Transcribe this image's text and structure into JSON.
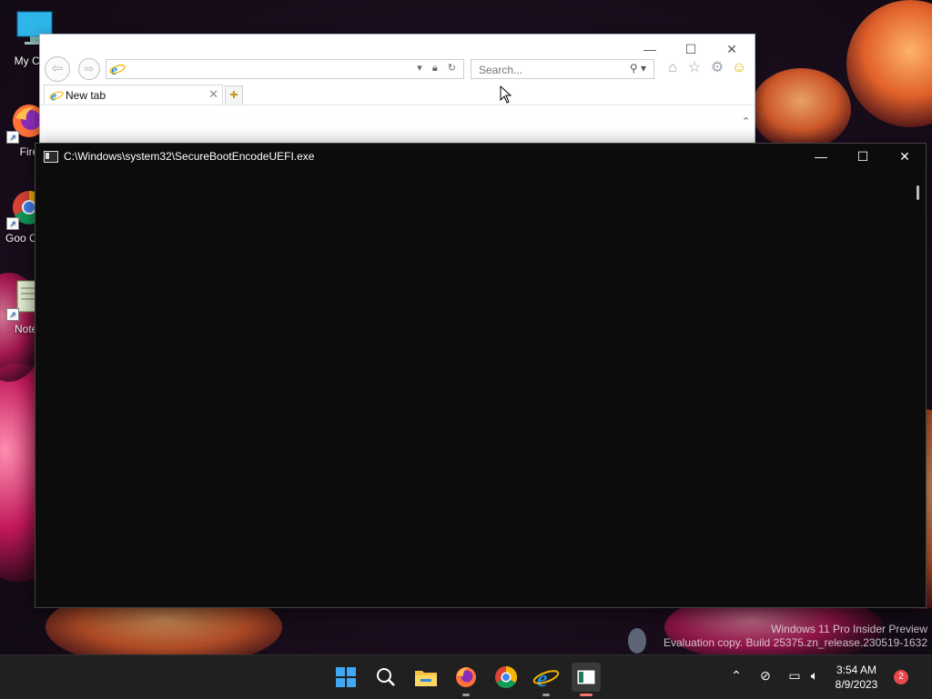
{
  "desktop": {
    "icons": [
      {
        "label": "My Com",
        "icon": "computer-icon"
      },
      {
        "label": "Fire",
        "icon": "firefox-icon"
      },
      {
        "label": "Goo Chro",
        "icon": "chrome-icon"
      },
      {
        "label": "Notep",
        "icon": "notepad-icon"
      }
    ],
    "watermark": {
      "line1": "Windows 11 Pro Insider Preview",
      "line2": "Evaluation copy. Build 25375.zn_release.230519-1632"
    }
  },
  "ie_window": {
    "caption_buttons": {
      "minimize": "—",
      "maximize": "☐",
      "close": "✕"
    },
    "address_value": "",
    "search_placeholder": "Search...",
    "tab_label": "New tab",
    "toolbar_icons": [
      "home-icon",
      "favorites-star-icon",
      "settings-gear-icon",
      "smiley-feedback-icon"
    ]
  },
  "console_window": {
    "title": "C:\\Windows\\system32\\SecureBootEncodeUEFI.exe",
    "caption_buttons": {
      "minimize": "—",
      "maximize": "☐",
      "close": "✕"
    },
    "content": ""
  },
  "taskbar": {
    "apps": [
      "start-icon",
      "search-icon",
      "file-explorer-icon",
      "firefox-icon",
      "chrome-icon",
      "internet-explorer-icon",
      "console-icon"
    ],
    "clock_time": "3:54 AM",
    "clock_date": "8/9/2023",
    "notification_count": "2"
  },
  "colors": {
    "taskbar_bg": "#202020",
    "console_bg": "#0c0c0c",
    "accent": "#0078d4"
  }
}
